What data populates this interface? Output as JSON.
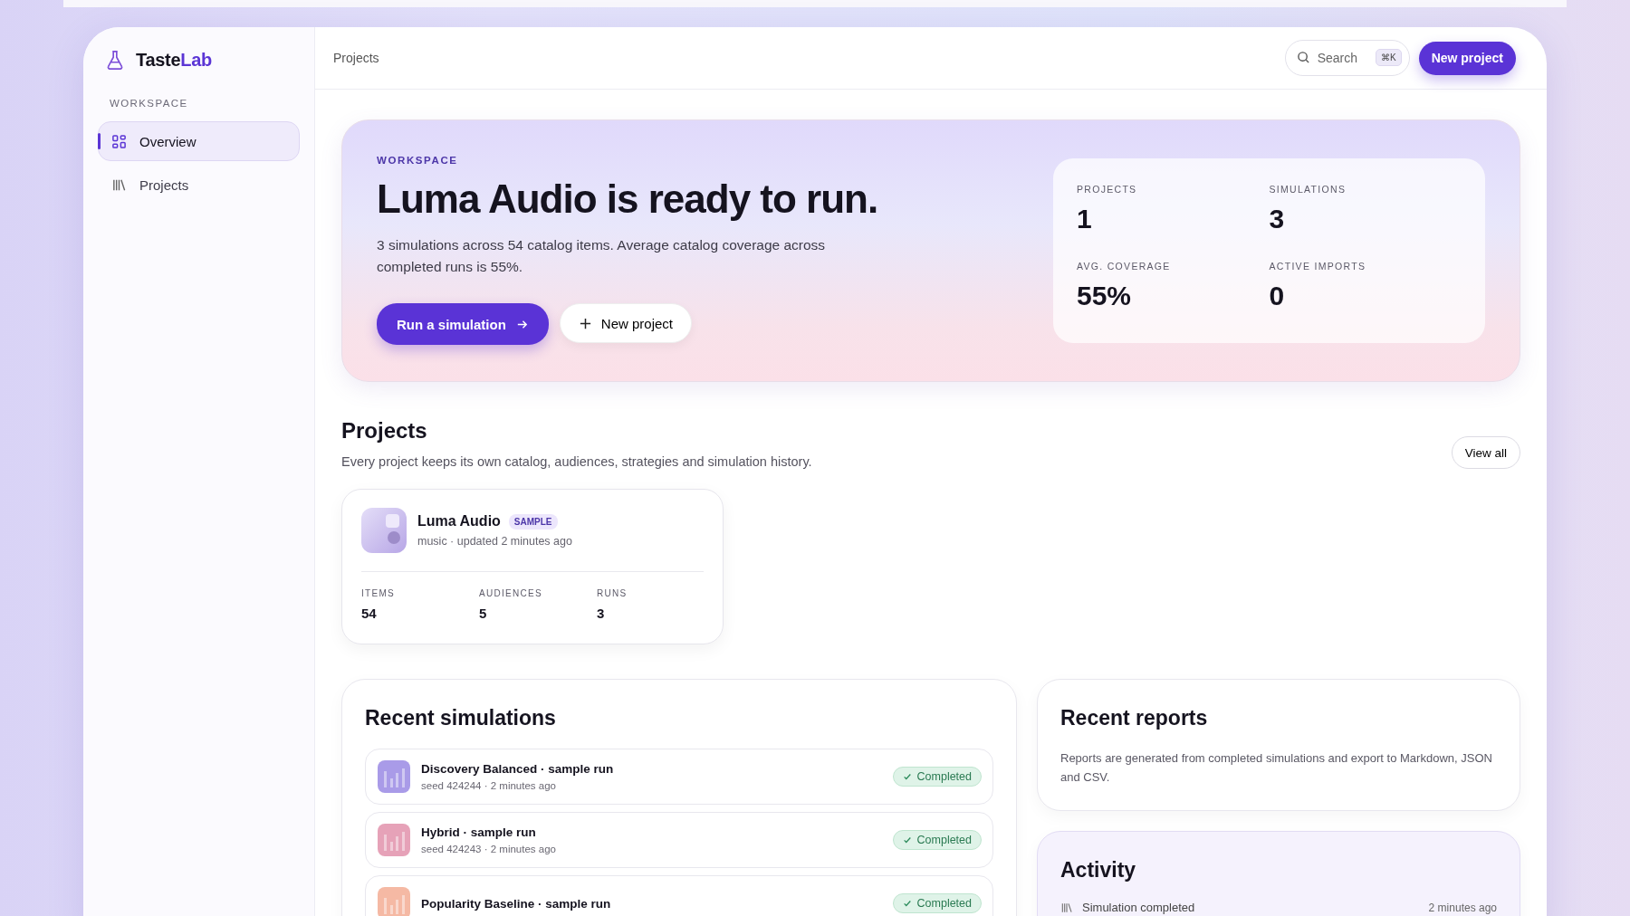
{
  "brand": {
    "name": "Taste",
    "accent": "Lab"
  },
  "sidebar": {
    "section": "WORKSPACE",
    "items": [
      {
        "label": "Overview",
        "kind": "grid",
        "selected": true
      },
      {
        "label": "Projects",
        "kind": "library",
        "selected": false
      }
    ]
  },
  "header": {
    "breadcrumb": "Projects",
    "search": {
      "placeholder": "Search",
      "shortcut": "⌘K"
    },
    "button": "New project"
  },
  "hero": {
    "eyebrow": "WORKSPACE",
    "title": "Luma Audio is ready to run.",
    "text": "3 simulations across 54 catalog items. Average catalog coverage across completed runs is 55%.",
    "primary": "Run a simulation",
    "secondary": "New project",
    "stats": [
      {
        "label": "PROJECTS",
        "value": "1"
      },
      {
        "label": "SIMULATIONS",
        "value": "3"
      },
      {
        "label": "AVG. COVERAGE",
        "value": "55%"
      },
      {
        "label": "ACTIVE IMPORTS",
        "value": "0"
      }
    ]
  },
  "projects": {
    "title": "Projects",
    "subtitle": "Every project keeps its own catalog, audiences, strategies and simulation history.",
    "view_all": "View all",
    "cards": [
      {
        "name": "Luma Audio",
        "badge": "SAMPLE",
        "meta": "music · updated 2 minutes ago",
        "stats": [
          {
            "label": "ITEMS",
            "value": "54"
          },
          {
            "label": "AUDIENCES",
            "value": "5"
          },
          {
            "label": "RUNS",
            "value": "3"
          }
        ]
      }
    ]
  },
  "simulations": {
    "title": "Recent simulations",
    "rows": [
      {
        "title": "Discovery Balanced · sample run",
        "meta": "seed 424244 · 2 minutes ago",
        "status": "Completed",
        "color": "#a99be8"
      },
      {
        "title": "Hybrid · sample run",
        "meta": "seed 424243 · 2 minutes ago",
        "status": "Completed",
        "color": "#e6a2b8"
      },
      {
        "title": "Popularity Baseline · sample run",
        "status": "Completed",
        "color": "#f5b9a4"
      }
    ]
  },
  "reports": {
    "title": "Recent reports",
    "text": "Reports are generated from completed simulations and export to Markdown, JSON and CSV."
  },
  "activity": {
    "title": "Activity",
    "rows": [
      {
        "text": "Simulation completed",
        "time": "2 minutes ago"
      }
    ]
  }
}
